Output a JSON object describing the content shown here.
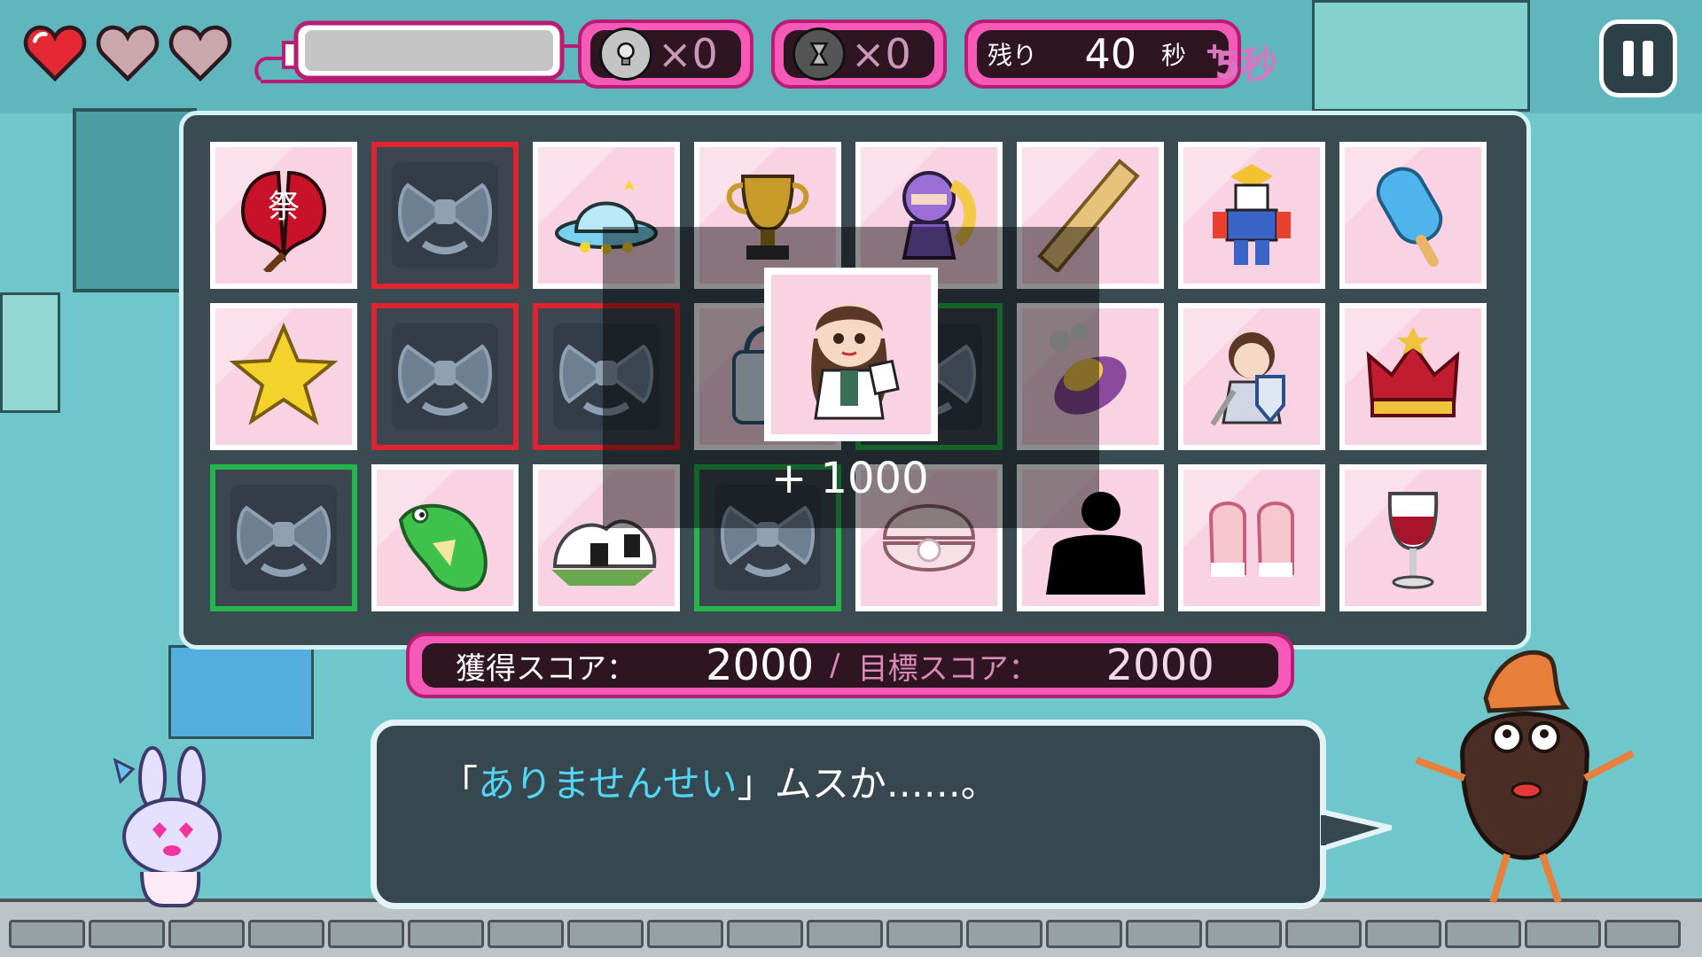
{
  "hud": {
    "hearts": [
      {
        "name": "heart-full-icon",
        "state": "full"
      },
      {
        "name": "heart-empty-icon",
        "state": "empty"
      },
      {
        "name": "heart-empty-icon",
        "state": "empty"
      }
    ],
    "hint_count": "×0",
    "timer_item_count": "×0",
    "timer_label": "残り",
    "timer_value": "40",
    "timer_unit": "秒",
    "bonus": "5秒"
  },
  "board": {
    "cards": [
      {
        "row": 0,
        "col": 0,
        "item": "festival-fan-icon",
        "state": "face-up"
      },
      {
        "row": 0,
        "col": 1,
        "item": "bow-icon",
        "state": "back-red"
      },
      {
        "row": 0,
        "col": 2,
        "item": "ufo-icon",
        "state": "face-up"
      },
      {
        "row": 0,
        "col": 3,
        "item": "trophy-icon",
        "state": "face-up"
      },
      {
        "row": 0,
        "col": 4,
        "item": "ninja-girl-icon",
        "state": "face-up"
      },
      {
        "row": 0,
        "col": 5,
        "item": "ruler-icon",
        "state": "face-up"
      },
      {
        "row": 0,
        "col": 6,
        "item": "robot-icon",
        "state": "face-up"
      },
      {
        "row": 0,
        "col": 7,
        "item": "popsicle-icon",
        "state": "face-up"
      },
      {
        "row": 1,
        "col": 0,
        "item": "star-icon",
        "state": "face-up"
      },
      {
        "row": 1,
        "col": 1,
        "item": "bow-icon",
        "state": "back-red"
      },
      {
        "row": 1,
        "col": 2,
        "item": "bow-icon",
        "state": "back-red"
      },
      {
        "row": 1,
        "col": 3,
        "item": "bag-icon",
        "state": "face-up"
      },
      {
        "row": 1,
        "col": 4,
        "item": "bow-icon",
        "state": "back-green"
      },
      {
        "row": 1,
        "col": 5,
        "item": "sweet-potato-icon",
        "state": "face-up"
      },
      {
        "row": 1,
        "col": 6,
        "item": "knight-girl-icon",
        "state": "face-up"
      },
      {
        "row": 1,
        "col": 7,
        "item": "crown-icon",
        "state": "face-up"
      },
      {
        "row": 2,
        "col": 0,
        "item": "bow-icon",
        "state": "back-green"
      },
      {
        "row": 2,
        "col": 1,
        "item": "crocodile-icon",
        "state": "face-up"
      },
      {
        "row": 2,
        "col": 2,
        "item": "rice-ball-icon",
        "state": "face-up"
      },
      {
        "row": 2,
        "col": 3,
        "item": "bow-icon",
        "state": "back-green"
      },
      {
        "row": 2,
        "col": 4,
        "item": "pearl-shell-icon",
        "state": "face-up"
      },
      {
        "row": 2,
        "col": 5,
        "item": "silhouette-icon",
        "state": "face-up"
      },
      {
        "row": 2,
        "col": 6,
        "item": "mittens-icon",
        "state": "face-up"
      },
      {
        "row": 2,
        "col": 7,
        "item": "wine-glass-icon",
        "state": "face-up"
      }
    ],
    "popup": {
      "item": "scientist-girl-icon",
      "score": "+ 1000"
    }
  },
  "score": {
    "earned_label": "獲得スコア：",
    "earned_value": "2000",
    "separator": "/",
    "target_label": "目標スコア：",
    "target_value": "2000"
  },
  "dialogue": {
    "open": "「",
    "highlight": "ありませんせい",
    "rest": "」ムスか……。"
  },
  "colors": {
    "accent_pink": "#f55ab9",
    "dark_panel": "#2f1522",
    "board_bg": "#3a4b52",
    "highlight_blue": "#52d6f4"
  }
}
